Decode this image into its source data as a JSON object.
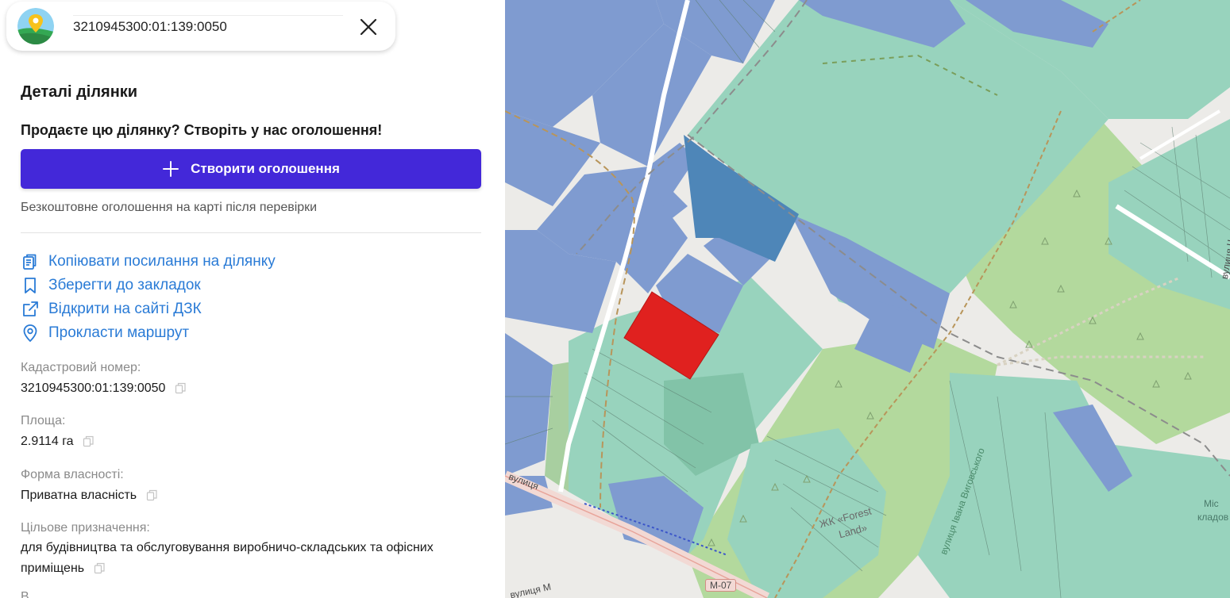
{
  "search": {
    "value": "3210945300:01:139:0050"
  },
  "icons": {
    "logo": "map-pin-logo-icon",
    "close": "close-icon",
    "plus": "plus-icon",
    "copy_link": "clipboard-copy-icon",
    "bookmark": "bookmark-icon",
    "external": "external-link-icon",
    "route": "location-pin-icon",
    "copy": "copy-icon"
  },
  "panel": {
    "title": "Деталі ділянки",
    "sell_prompt": "Продаєте цю ділянку? Створіть у нас оголошення!",
    "create_button": "Створити оголошення",
    "free_note": "Безкоштовне оголошення на карті після перевірки",
    "actions": [
      {
        "label": "Копіювати посилання на ділянку"
      },
      {
        "label": "Зберегти до закладок"
      },
      {
        "label": "Відкрити на сайті ДЗК"
      },
      {
        "label": "Прокласти маршрут"
      }
    ],
    "fields": [
      {
        "label": "Кадастровий номер:",
        "value": "3210945300:01:139:0050"
      },
      {
        "label": "Площа:",
        "value": "2.9114 га"
      },
      {
        "label": "Форма власності:",
        "value": "Приватна власність"
      },
      {
        "label": "Цільове призначення:",
        "value_line1": "для будівництва та обслуговування виробничо-складських та офісних",
        "value_line2": "приміщень"
      }
    ],
    "cut_label": "В"
  },
  "map": {
    "labels": {
      "street_left": "вулиця",
      "street_bottom": "вулиця М",
      "highway": "М-07",
      "forest_name_1": "ЖК «Forest",
      "forest_name_2": "Land»",
      "street_vyhivsk": "вулиця Івана Виговського",
      "cemetery_1": "Міс",
      "cemetery_2": "кладов",
      "street_right": "вулиця Ч"
    },
    "colors": {
      "selected_parcel": "#e0211f",
      "industrial": "#7f9bd0",
      "agricultural": "#98d3bd",
      "forest": "#b3d99d",
      "highlight": "#4e86b8"
    }
  }
}
